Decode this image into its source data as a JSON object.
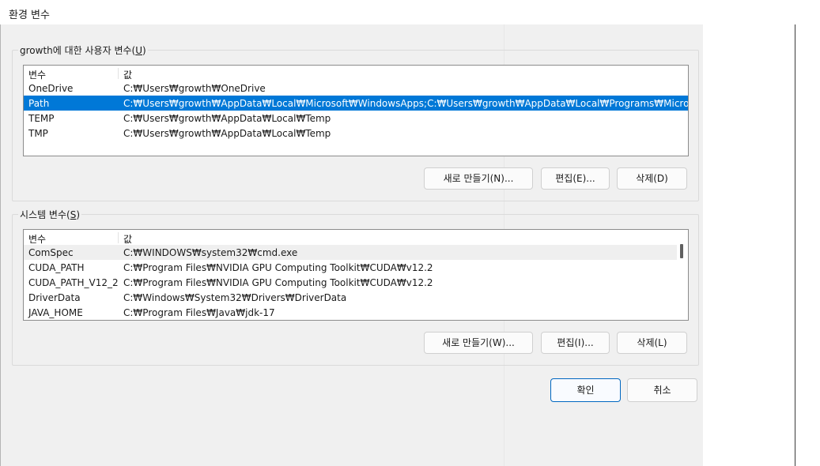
{
  "window": {
    "title": "환경 변수"
  },
  "user_vars": {
    "group_label_prefix": "growth에 대한 사용자 변수(",
    "group_label_key": "U",
    "group_label_suffix": ")",
    "columns": [
      "변수",
      "값"
    ],
    "rows": [
      {
        "name": "OneDrive",
        "value": "C:₩Users₩growth₩OneDrive"
      },
      {
        "name": "Path",
        "value": "C:₩Users₩growth₩AppData₩Local₩Microsoft₩WindowsApps;C:₩Users₩growth₩AppData₩Local₩Programs₩Microsoft VS Code..."
      },
      {
        "name": "TEMP",
        "value": "C:₩Users₩growth₩AppData₩Local₩Temp"
      },
      {
        "name": "TMP",
        "value": "C:₩Users₩growth₩AppData₩Local₩Temp"
      }
    ],
    "selected_index": 1,
    "buttons": {
      "new": "새로 만들기(N)...",
      "edit": "편집(E)...",
      "delete": "삭제(D)"
    }
  },
  "system_vars": {
    "group_label_prefix": "시스템 변수(",
    "group_label_key": "S",
    "group_label_suffix": ")",
    "columns": [
      "변수",
      "값"
    ],
    "rows": [
      {
        "name": "ComSpec",
        "value": "C:₩WINDOWS₩system32₩cmd.exe"
      },
      {
        "name": "CUDA_PATH",
        "value": "C:₩Program Files₩NVIDIA GPU Computing Toolkit₩CUDA₩v12.2"
      },
      {
        "name": "CUDA_PATH_V12_2",
        "value": "C:₩Program Files₩NVIDIA GPU Computing Toolkit₩CUDA₩v12.2"
      },
      {
        "name": "DriverData",
        "value": "C:₩Windows₩System32₩Drivers₩DriverData"
      },
      {
        "name": "JAVA_HOME",
        "value": "C:₩Program Files₩Java₩jdk-17"
      }
    ],
    "hover_index": 0,
    "buttons": {
      "new": "새로 만들기(W)...",
      "edit": "편집(I)...",
      "delete": "삭제(L)"
    }
  },
  "footer": {
    "ok": "확인",
    "cancel": "취소"
  },
  "colors": {
    "selection": "#0078d7",
    "primary_border": "#0067c0"
  }
}
